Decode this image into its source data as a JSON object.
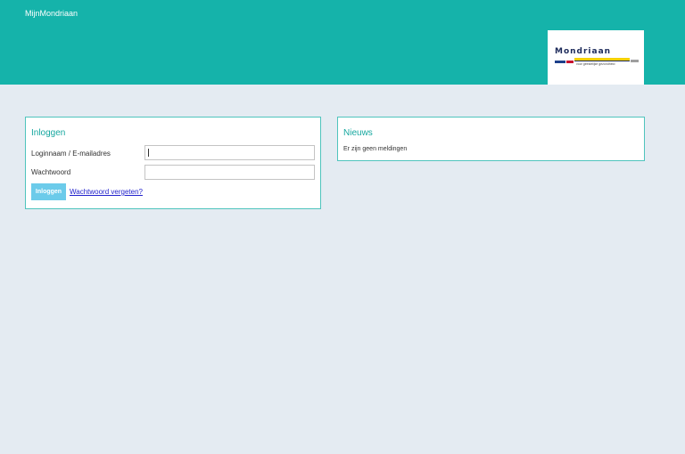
{
  "header": {
    "app_title": "MijnMondriaan",
    "logo": {
      "name": "Mondriaan",
      "tagline": "voor geestelijke gezondheid",
      "colors": [
        "#1c3f8a",
        "#c8102e",
        "#f5d000",
        "#1c2a5a",
        "#9e9e9e"
      ]
    }
  },
  "login": {
    "title": "Inloggen",
    "username_label": "Loginnaam / E-mailadres",
    "username_value": "",
    "password_label": "Wachtwoord",
    "password_value": "",
    "submit_label": "Inloggen",
    "forgot_link": "Wachtwoord vergeten?"
  },
  "news": {
    "title": "Nieuws",
    "message": "Er zijn geen meldingen"
  },
  "colors": {
    "header": "#15b3aa",
    "accent_title": "#15a79f",
    "panel_border": "#4fc4bd",
    "button": "#6ccbea",
    "background": "#e4ebf2"
  }
}
